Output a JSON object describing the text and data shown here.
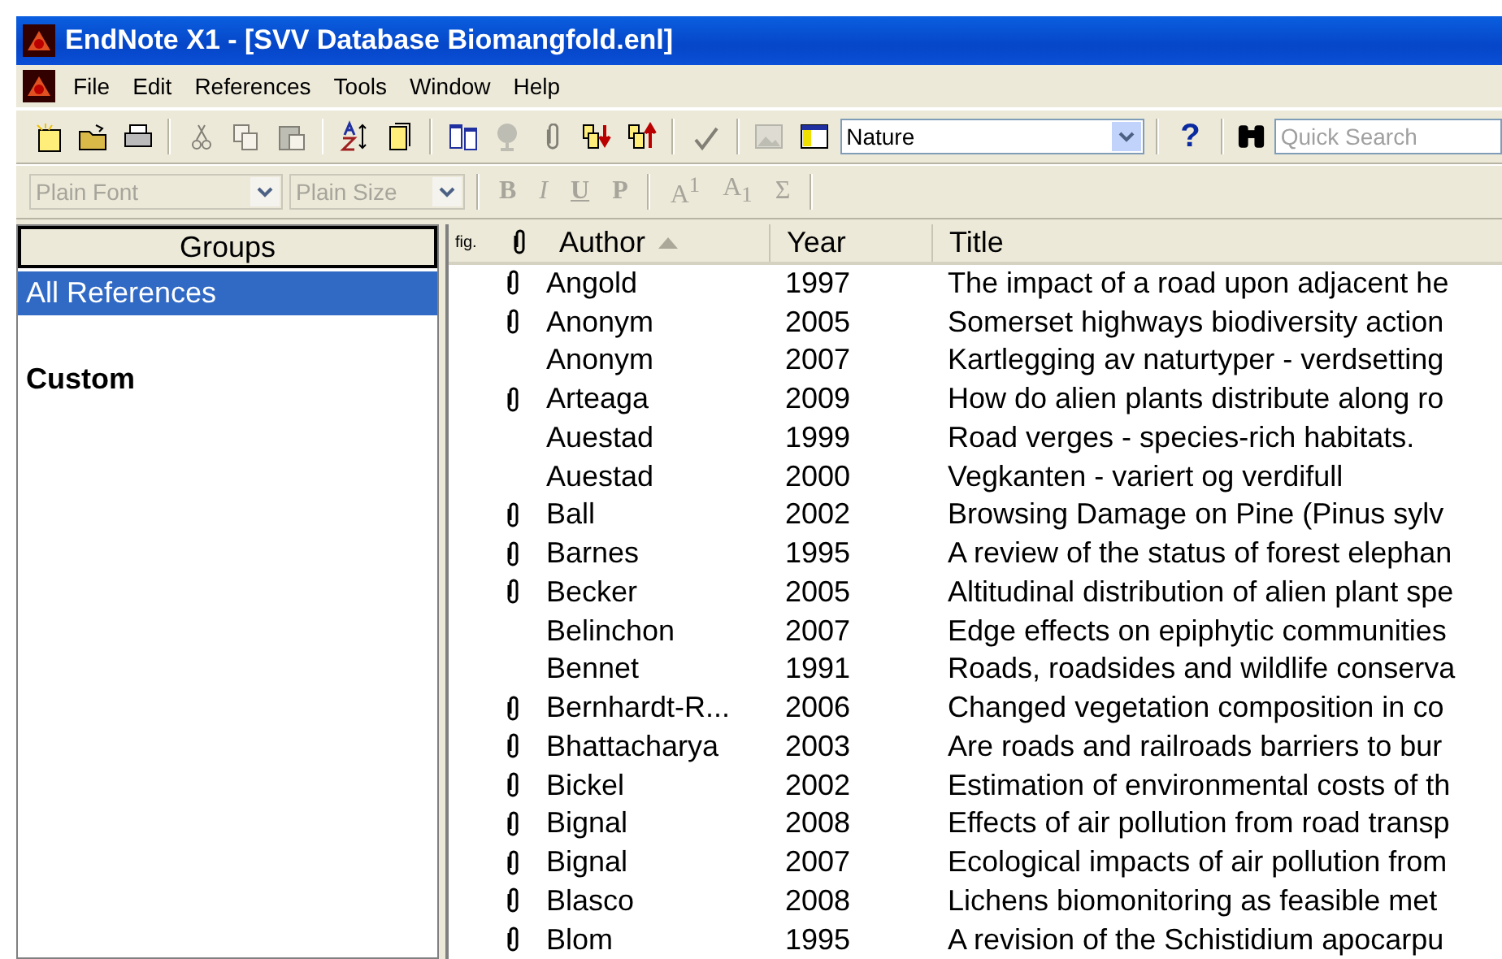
{
  "window": {
    "title": "EndNote X1 - [SVV Database Biomangfold.enl]"
  },
  "menu": [
    "File",
    "Edit",
    "References",
    "Tools",
    "Window",
    "Help"
  ],
  "toolbar": [
    {
      "disabled": false
    },
    {
      "disabled": false
    },
    {
      "disabled": false
    },
    {
      "disabled": true
    },
    {
      "disabled": true
    },
    {
      "disabled": true
    },
    {
      "disabled": false
    },
    {
      "disabled": false
    },
    {
      "disabled": false
    },
    {
      "disabled": true
    },
    {
      "disabled": true
    },
    {
      "disabled": false
    },
    {
      "disabled": false
    },
    {
      "disabled": true
    },
    {
      "disabled": true
    },
    {
      "disabled": false
    }
  ],
  "style_select": {
    "value": "Nature"
  },
  "help": "?",
  "quick_search": {
    "placeholder": "Quick Search"
  },
  "format_bar": {
    "font": "Plain Font",
    "size": "Plain Size",
    "buttons": [
      {
        "label": "B",
        "kind": "bold",
        "disabled": true
      },
      {
        "label": "I",
        "kind": "italic",
        "disabled": true
      },
      {
        "label": "U",
        "kind": "underline",
        "disabled": true
      },
      {
        "label": "P",
        "kind": "plain",
        "disabled": true
      },
      {
        "label": "A$^{1}$",
        "kind": "script",
        "disabled": true
      },
      {
        "label": "A$_{1}$",
        "kind": "script",
        "disabled": true
      },
      {
        "label": "Σ",
        "kind": "symbol",
        "disabled": true
      }
    ]
  },
  "groups": {
    "header": "Groups",
    "items": [
      {
        "label": "All References",
        "kind": "group",
        "selected": true
      },
      {
        "label": "Custom",
        "kind": "heading",
        "selected": false
      }
    ]
  },
  "table": {
    "figure_header": "fig.",
    "columns": [
      {
        "label": "Author",
        "sorted": true
      },
      {
        "label": "Year",
        "sorted": false
      },
      {
        "label": "Title",
        "sorted": false
      }
    ],
    "rows": [
      {
        "attachment": true,
        "author": "Angold",
        "year": "1997",
        "title": "The impact of a road upon adjacent he"
      },
      {
        "attachment": true,
        "author": "Anonym",
        "year": "2005",
        "title": "Somerset highways biodiversity action"
      },
      {
        "attachment": false,
        "author": "Anonym",
        "year": "2007",
        "title": "Kartlegging av naturtyper - verdsetting"
      },
      {
        "attachment": true,
        "author": "Arteaga",
        "year": "2009",
        "title": "How do alien plants distribute along ro"
      },
      {
        "attachment": false,
        "author": "Auestad",
        "year": "1999",
        "title": "Road verges - species-rich habitats."
      },
      {
        "attachment": false,
        "author": "Auestad",
        "year": "2000",
        "title": "Vegkanten - variert og verdifull"
      },
      {
        "attachment": true,
        "author": "Ball",
        "year": "2002",
        "title": "Browsing Damage on Pine (Pinus sylv"
      },
      {
        "attachment": true,
        "author": "Barnes",
        "year": "1995",
        "title": "A review of the status of forest elephan"
      },
      {
        "attachment": true,
        "author": "Becker",
        "year": "2005",
        "title": "Altitudinal distribution of alien plant spe"
      },
      {
        "attachment": false,
        "author": "Belinchon",
        "year": "2007",
        "title": "Edge effects on epiphytic communities"
      },
      {
        "attachment": false,
        "author": "Bennet",
        "year": "1991",
        "title": "Roads, roadsides and wildlife conserva"
      },
      {
        "attachment": true,
        "author": "Bernhardt-R...",
        "year": "2006",
        "title": "Changed vegetation composition in co"
      },
      {
        "attachment": true,
        "author": "Bhattacharya",
        "year": "2003",
        "title": "Are roads and railroads barriers to bur"
      },
      {
        "attachment": true,
        "author": "Bickel",
        "year": "2002",
        "title": "Estimation of environmental costs of th"
      },
      {
        "attachment": true,
        "author": "Bignal",
        "year": "2008",
        "title": "Effects of air pollution from road transp"
      },
      {
        "attachment": true,
        "author": "Bignal",
        "year": "2007",
        "title": "Ecological impacts of air pollution from"
      },
      {
        "attachment": true,
        "author": "Blasco",
        "year": "2008",
        "title": "Lichens biomonitoring as feasible met"
      },
      {
        "attachment": true,
        "author": "Blom",
        "year": "1995",
        "title": "A revision of the Schistidium apocarpu"
      }
    ]
  }
}
